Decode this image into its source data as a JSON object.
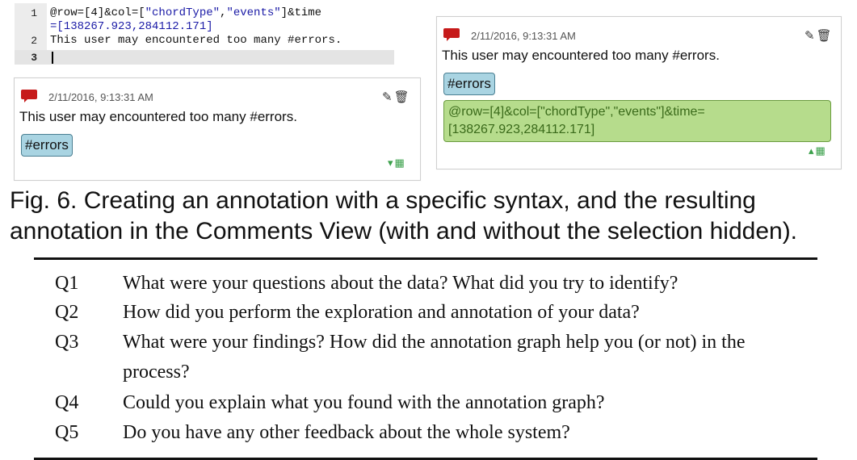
{
  "editor": {
    "lines": [
      {
        "number": "1",
        "text_a": "@row=[4]&col=[",
        "str1": "\"chordType\"",
        "comma": ",",
        "str2": "\"events\"",
        "text_b": "]&time"
      },
      {
        "number": "",
        "text": "=[138267.923,284112.171]"
      },
      {
        "number": "2",
        "text": "This user may encountered too many #errors."
      },
      {
        "number": "3",
        "text": ""
      }
    ]
  },
  "comment_card_collapsed": {
    "timestamp": "2/11/2016, 9:13:31 AM",
    "text": "This user may encountered too many #errors.",
    "tag": "#errors",
    "tool_icons": "✎🗑",
    "corner_icons": "▾▦"
  },
  "comment_card_expanded": {
    "timestamp": "2/11/2016, 9:13:31 AM",
    "text": "This user may encountered too many #errors.",
    "tag": "#errors",
    "selection_line1": "@row=[4]&col=[\"chordType\",\"events\"]&time=",
    "selection_line2": "[138267.923,284112.171]",
    "tool_icons": "✎🗑",
    "corner_icons": "▴▦"
  },
  "caption": "Fig. 6. Creating an annotation with a specific syntax, and the resulting annotation in the Comments View (with and without the selection hidden).",
  "questions": [
    {
      "label": "Q1",
      "text": "What were your questions about the data? What did you try to identify?"
    },
    {
      "label": "Q2",
      "text": "How did you perform the exploration and annotation of your data?"
    },
    {
      "label": "Q3",
      "text": "What were your findings? How did the annotation graph help you (or not) in the process?"
    },
    {
      "label": "Q4",
      "text": "Could you explain what you found with the annotation graph?"
    },
    {
      "label": "Q5",
      "text": "Do you have any other feedback about the whole system?"
    }
  ],
  "colors": {
    "flag": "#c61a1a",
    "tag_bg": "#a9d4e2",
    "selection_bg": "#b6dc8c",
    "string_literal": "#1a1aa6"
  }
}
